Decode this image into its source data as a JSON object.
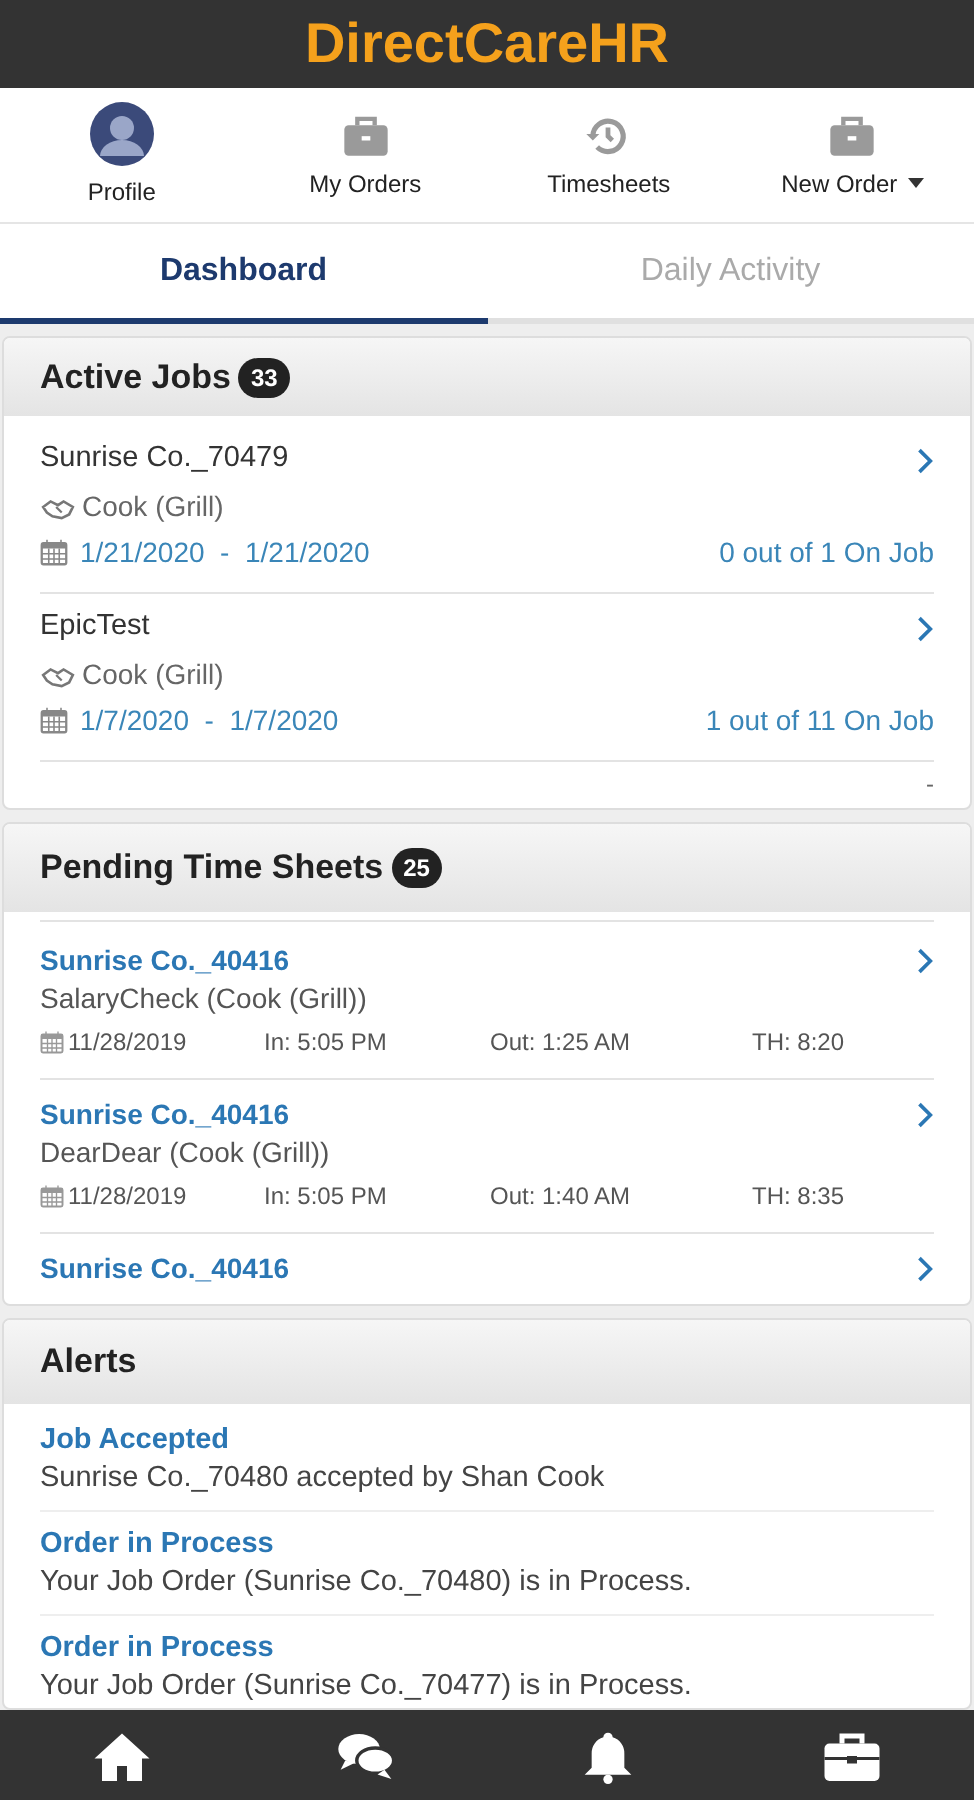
{
  "app_title": "DirectCareHR",
  "nav": [
    {
      "kind": "avatar",
      "label": "Profile"
    },
    {
      "kind": "briefcase",
      "label": "My Orders"
    },
    {
      "kind": "history",
      "label": "Timesheets"
    },
    {
      "kind": "dropdown",
      "label": "New Order"
    }
  ],
  "tabs": [
    {
      "label": "Dashboard",
      "selected": true
    },
    {
      "label": "Daily Activity",
      "selected": false
    }
  ],
  "active_jobs": {
    "title": "Active Jobs",
    "count": "33",
    "rows": [
      {
        "name": "Sunrise Co._70479",
        "role": "Cook (Grill)",
        "dates": "1/21/2020  -  1/21/2020",
        "staffing": "0 out of 1 On Job"
      },
      {
        "name": "EpicTest",
        "role": "Cook (Grill)",
        "dates": "1/7/2020  -  1/7/2020",
        "staffing": "1 out of 11 On Job"
      }
    ],
    "more": "-"
  },
  "pending_time_sheets": {
    "title": "Pending Time Sheets",
    "count": "25",
    "rows": [
      {
        "name": "Sunrise Co._40416",
        "detail": "SalaryCheck (Cook (Grill))",
        "date": "11/28/2019",
        "in": "In: 5:05 PM",
        "out": "Out: 1:25 AM",
        "th": "TH: 8:20"
      },
      {
        "name": "Sunrise Co._40416",
        "detail": "DearDear (Cook (Grill))",
        "date": "11/28/2019",
        "in": "In: 5:05 PM",
        "out": "Out: 1:40 AM",
        "th": "TH: 8:35"
      },
      {
        "name": "Sunrise Co._40416"
      }
    ]
  },
  "alerts": {
    "title": "Alerts",
    "items": [
      {
        "title": "Job Accepted",
        "message": "Sunrise Co._70480 accepted by Shan Cook"
      },
      {
        "title": "Order in Process",
        "message": "Your Job Order (Sunrise Co._70480) is in Process."
      },
      {
        "title": "Order in Process",
        "message": "Your Job Order (Sunrise Co._70477) is in Process."
      }
    ]
  }
}
